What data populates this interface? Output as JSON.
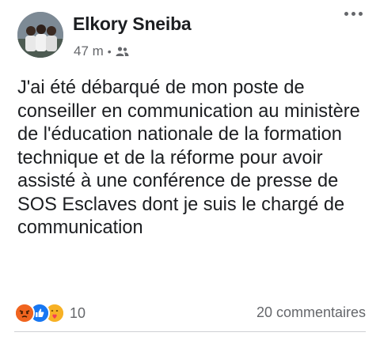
{
  "post": {
    "author": "Elkory Sneiba",
    "time": "47 m",
    "separator": "•",
    "audience_icon": "friends-icon",
    "text": "J'ai été débarqué de mon poste de conseiller en communication au ministère de l'éducation nationale de la formation technique et de la réforme pour avoir assisté à une conférence de presse de SOS Esclaves dont je suis le chargé de communication"
  },
  "reactions": {
    "icons": [
      "angry-reaction-icon",
      "like-reaction-icon",
      "care-reaction-icon"
    ],
    "count": "10"
  },
  "comments_label": "20 commentaires"
}
